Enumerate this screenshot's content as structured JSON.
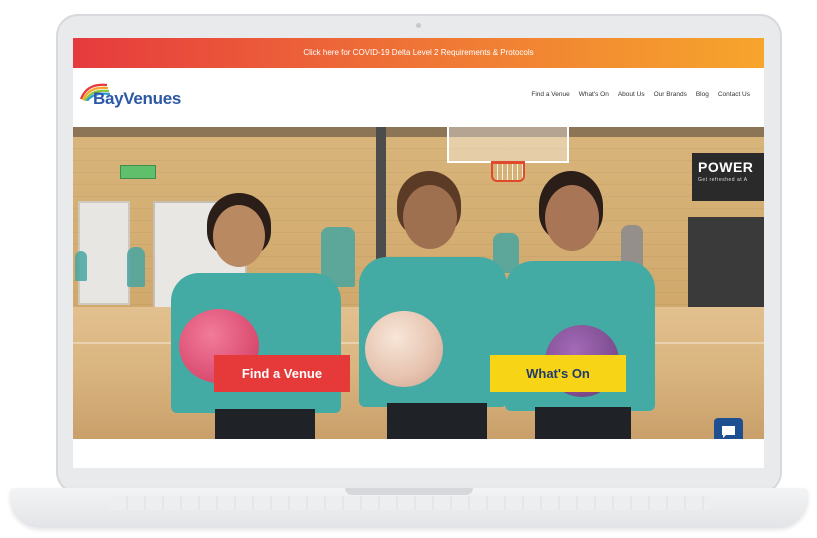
{
  "banner": {
    "text": "Click here for COVID-19 Delta Level 2 Requirements & Protocols",
    "gradient_start": "#e63a3e",
    "gradient_end": "#f6a52c"
  },
  "header": {
    "logo_text": "BayVenues",
    "logo_color": "#2c58a6"
  },
  "nav": {
    "items": [
      {
        "label": "Find a Venue"
      },
      {
        "label": "What's On"
      },
      {
        "label": "About Us"
      },
      {
        "label": "Our Brands"
      },
      {
        "label": "Blog"
      },
      {
        "label": "Contact Us"
      }
    ]
  },
  "hero": {
    "power_sign": "POWER",
    "power_sub": "Get refreshed at A",
    "buttons": {
      "find_venue": {
        "label": "Find a Venue",
        "color": "#e63a3a"
      },
      "whats_on": {
        "label": "What's On",
        "color": "#f7d516"
      }
    }
  },
  "chat": {
    "icon": "chat-icon",
    "color": "#1d4f91"
  }
}
